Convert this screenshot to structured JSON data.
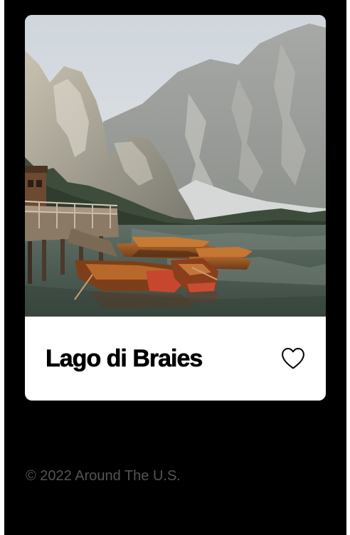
{
  "card": {
    "title": "Lago di Braies",
    "image_alt": "Wooden boats moored by a pier on a mountain lake",
    "liked": false,
    "like_icon": "heart-outline-icon"
  },
  "footer": {
    "copyright": "© 2022 Around The U.S."
  },
  "colors": {
    "page_background": "#000000",
    "card_background": "#ffffff",
    "title_text": "#000000",
    "footer_text": "#545454"
  }
}
